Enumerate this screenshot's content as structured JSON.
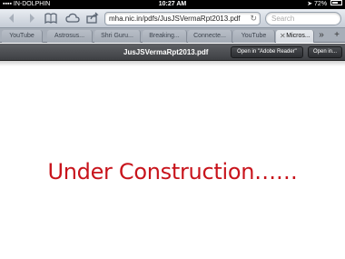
{
  "status_bar": {
    "carrier": "IN-DOLPHIN",
    "time": "10:27 AM",
    "battery": "72%",
    "battery_level": 0.72
  },
  "toolbar": {
    "url": "mha.nic.in/pdfs/JusJSVermaRpt2013.pdf",
    "search_placeholder": "Search",
    "icons": [
      "back-icon",
      "forward-icon",
      "bookmarks-icon",
      "icloud-tabs-icon",
      "share-icon",
      "reload-icon"
    ]
  },
  "tabs": [
    {
      "label": "YouTube",
      "active": false
    },
    {
      "label": "Astrosus...",
      "active": false
    },
    {
      "label": "Shri Guru...",
      "active": false
    },
    {
      "label": "Breaking...",
      "active": false
    },
    {
      "label": "Connecte...",
      "active": false
    },
    {
      "label": "YouTube",
      "active": false
    },
    {
      "label": "Micros...",
      "active": true
    }
  ],
  "pdf_bar": {
    "title": "JusJSVermaRpt2013.pdf",
    "open_in_adobe": "Open in \"Adobe Reader\"",
    "open_in": "Open in..."
  },
  "document": {
    "text": "Under Construction……"
  },
  "colors": {
    "doc_text": "#c8141c"
  }
}
